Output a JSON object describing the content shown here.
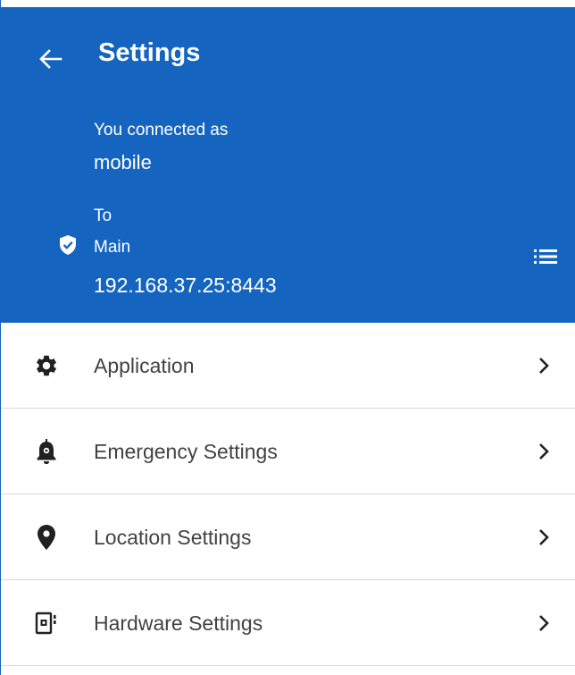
{
  "header": {
    "title": "Settings",
    "connected_label": "You connected as",
    "username": "mobile",
    "to_label": "To",
    "server_name": "Main",
    "server_address": "192.168.37.25:8443",
    "background_color": "#1565c0",
    "icons": {
      "back": "arrow-left-icon",
      "secure": "verified-shield-icon",
      "servers": "list-icon"
    }
  },
  "menu": {
    "items": [
      {
        "label": "Application",
        "icon": "gear-icon"
      },
      {
        "label": "Emergency Settings",
        "icon": "alarm-bell-icon"
      },
      {
        "label": "Location Settings",
        "icon": "location-pin-icon"
      },
      {
        "label": "Hardware Settings",
        "icon": "hardware-device-icon"
      }
    ],
    "chevron_icon": "chevron-right-icon"
  }
}
